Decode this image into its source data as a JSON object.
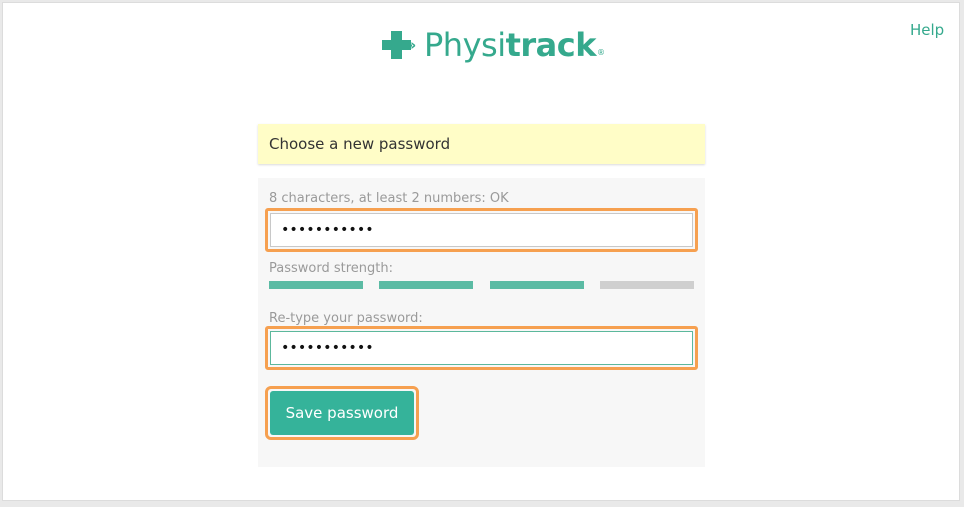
{
  "logo": {
    "text_light": "Physi",
    "text_bold": "track",
    "trademark": "®"
  },
  "header": {
    "help_link": "Help"
  },
  "notice": {
    "text": "Choose a new password"
  },
  "form": {
    "password_hint": "8 characters, at least 2 numbers: OK",
    "password_value": "•••••••••••",
    "strength_label": "Password strength:",
    "strength_segments": [
      {
        "active": true,
        "color": "#5bbba4"
      },
      {
        "active": true,
        "color": "#5bbba4"
      },
      {
        "active": true,
        "color": "#5bbba4"
      },
      {
        "active": false,
        "color": "#cfcfcf"
      }
    ],
    "retype_label": "Re-type your password:",
    "retype_value": "•••••••••••",
    "save_label": "Save password"
  },
  "colors": {
    "brand": "#35a98d",
    "button": "#35b39a",
    "highlight": "#f6a050",
    "notice_bg": "#fffdc7"
  }
}
